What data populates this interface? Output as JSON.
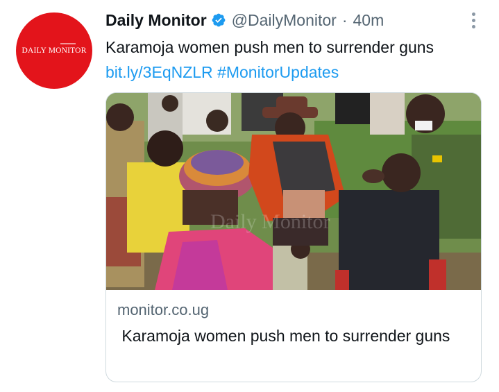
{
  "tweet": {
    "author": {
      "name": "Daily Monitor",
      "handle": "@DailyMonitor",
      "time": "40m",
      "avatar_text": "DAILY MONITOR",
      "verified_icon": "verified-badge-icon",
      "avatar_color": "#e3141b"
    },
    "separator": "·",
    "text_main": "Karamoja women push men to surrender guns",
    "text_link": "bit.ly/3EqNZLR",
    "text_hashtag": "#MonitorUpdates",
    "more_icon": "more-options-icon"
  },
  "card": {
    "image_watermark": "Daily Monitor",
    "domain": "monitor.co.ug",
    "title": " Karamoja women push men to surrender guns"
  },
  "colors": {
    "link": "#1d9bf0",
    "secondary_text": "#536471",
    "verified": "#1d9bf0"
  }
}
